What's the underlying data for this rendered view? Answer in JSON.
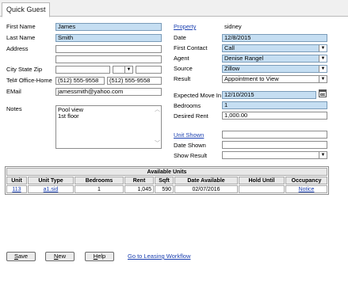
{
  "tab": {
    "label": "Quick Guest"
  },
  "left": {
    "first_name_label": "First Name",
    "first_name_value": "James",
    "last_name_label": "Last Name",
    "last_name_value": "Smith",
    "address_label": "Address",
    "address_line1": "",
    "address_line2": "",
    "city_state_zip_label": "City State Zip",
    "city_value": "",
    "state_value": "",
    "zip_value": "",
    "phone_label": "Tel# Office-Home",
    "office_phone": "(512) 555-9558",
    "home_phone": "(512) 555-9558",
    "email_label": "EMail",
    "email_value": "jamessmith@yahoo.com",
    "notes_label": "Notes",
    "notes_line1": "Pool view",
    "notes_line2": "1st floor"
  },
  "right": {
    "property_label": "Property",
    "property_value": "sidney",
    "date_label": "Date",
    "date_value": "12/8/2015",
    "first_contact_label": "First Contact",
    "first_contact_value": "Call",
    "agent_label": "Agent",
    "agent_value": "Denise Rangel",
    "source_label": "Source",
    "source_value": "Zillow",
    "result_label": "Result",
    "result_value": "Appointment to View",
    "move_in_label": "Expected Move In",
    "move_in_value": "12/10/2015",
    "bedrooms_label": "Bedrooms",
    "bedrooms_value": "1",
    "desired_rent_label": "Desired Rent",
    "desired_rent_value": "1,000.00",
    "unit_shown_label": "Unit Shown",
    "unit_shown_value": "",
    "date_shown_label": "Date Shown",
    "date_shown_value": "",
    "show_result_label": "Show Result",
    "show_result_value": ""
  },
  "units_table": {
    "title": "Available Units",
    "headers": [
      "Unit",
      "Unit Type",
      "Bedrooms",
      "Rent",
      "Sqft",
      "Date Available",
      "Hold Until",
      "Occupancy"
    ],
    "rows": [
      {
        "unit": "113",
        "unit_type": "a1.sid",
        "bedrooms": "1",
        "rent": "1,045",
        "sqft": "590",
        "date_available": "02/07/2016",
        "hold_until": "",
        "occupancy": "Notice"
      }
    ]
  },
  "buttons": {
    "save_first": "S",
    "save_rest": "ave",
    "new_first": "N",
    "new_rest": "ew",
    "help_first": "H",
    "help_rest": "elp",
    "workflow_link": "Go to Leasing Workflow"
  },
  "icons": {
    "dropdown": "chevron-down-icon",
    "calendar": "calendar-icon"
  },
  "colors": {
    "highlight_field": "#c5def2",
    "link": "#1a3fb0"
  }
}
